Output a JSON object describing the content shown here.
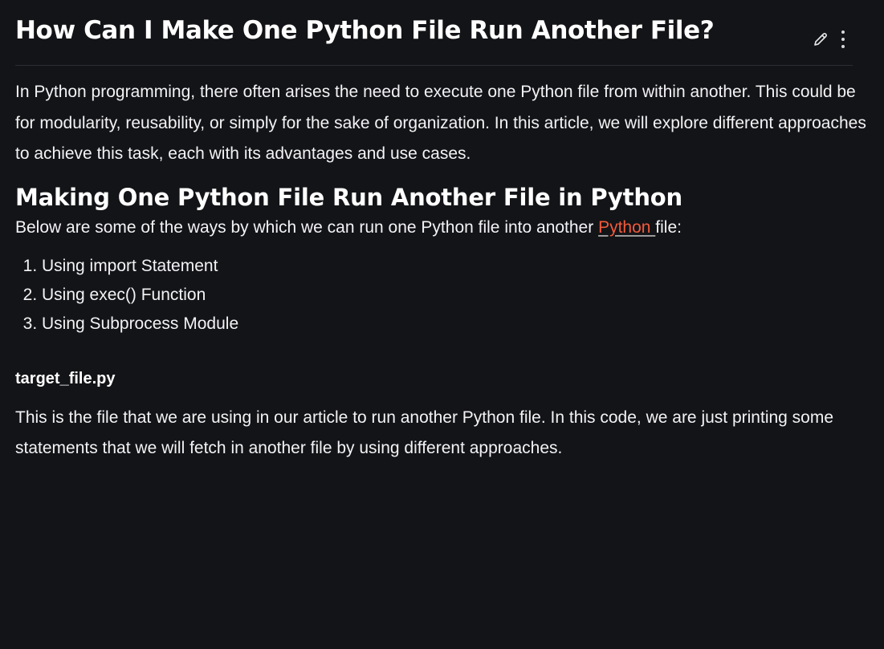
{
  "article": {
    "title": "How Can I Make One Python File Run Another File?",
    "intro": "In Python programming, there often arises the need to execute one Python file from within another. This could be for modularity, reusability, or simply for the sake of organization. In this article, we will explore different approaches to achieve this task, each with its advantages and use cases.",
    "section_heading": "Making One Python File Run Another File in Python",
    "lead_before": "Below are some of the ways by which we can run one Python file into another ",
    "lead_link": "Python ",
    "lead_after": "file:",
    "methods": [
      "Using import Statement",
      "Using exec() Function",
      "Using Subprocess Module"
    ],
    "file_label": "target_file.py",
    "file_description": "This is the file that we are using in our article to run another Python file. In this code, we are just printing some statements that we will fetch in another file by using different approaches."
  },
  "icons": {
    "edit": "pencil-icon",
    "more": "more-vertical-icon"
  },
  "colors": {
    "background": "#131417",
    "text": "#f3f3f5",
    "link": "#f25a3c",
    "divider": "#2c2e33"
  }
}
